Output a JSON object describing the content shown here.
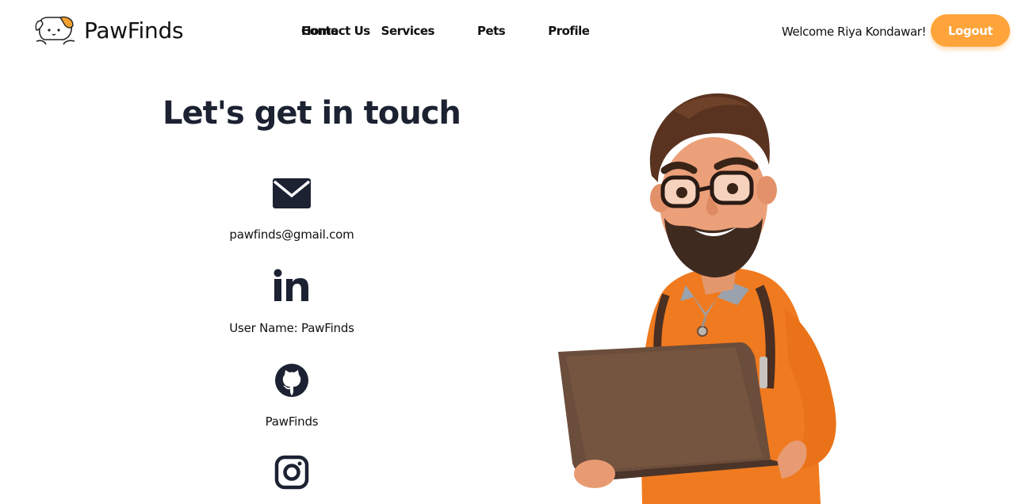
{
  "brand": {
    "name": "PawFinds",
    "logo_icon": "dog-logo-icon"
  },
  "nav": {
    "home": "Home",
    "services": "Services",
    "pets": "Pets",
    "profile": "Profile",
    "contact": "Contact Us"
  },
  "user": {
    "welcome": "Welcome Riya Kondawar!"
  },
  "logout": {
    "label": "Logout"
  },
  "contact": {
    "title": "Let's get in touch",
    "items": [
      {
        "icon": "email-icon",
        "label": "pawfinds@gmail.com"
      },
      {
        "icon": "linkedin-icon",
        "label": "User Name: PawFinds"
      },
      {
        "icon": "github-icon",
        "label": "PawFinds"
      },
      {
        "icon": "instagram-icon",
        "label": ""
      }
    ]
  },
  "colors": {
    "accent": "#ffa43a",
    "text": "#1c2232",
    "background": "#ffffff"
  }
}
